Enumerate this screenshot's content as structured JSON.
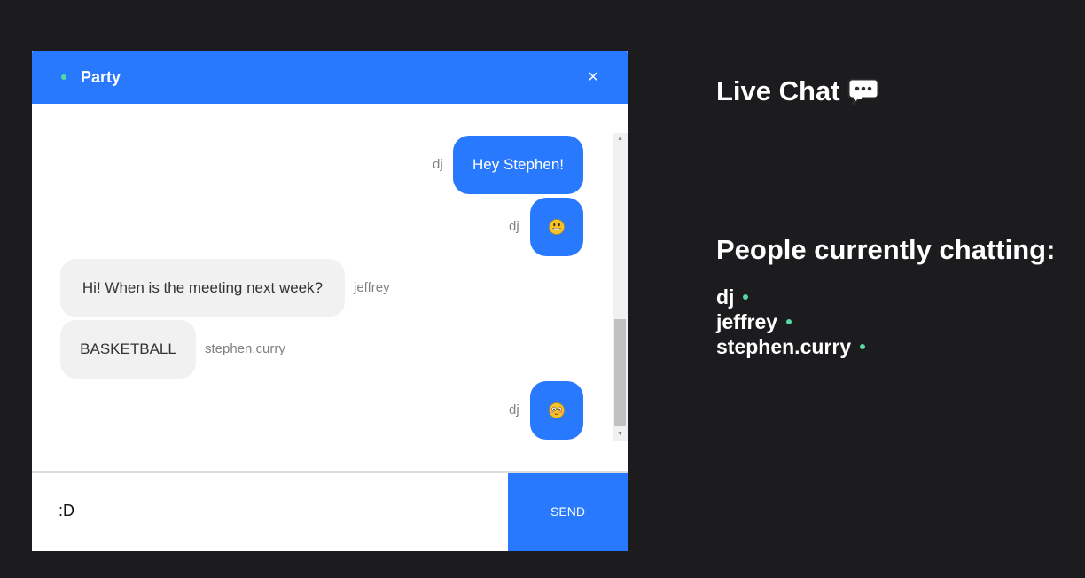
{
  "chat": {
    "room_name": "Party",
    "close_label": "×",
    "messages": [
      {
        "sender": "dj",
        "text": "Hey Stephen!",
        "mine": true
      },
      {
        "sender": "dj",
        "emoji": "grinning-face-emoji",
        "mine": true
      },
      {
        "sender": "jeffrey",
        "text": "Hi! When is the meeting next week?",
        "mine": false
      },
      {
        "sender": "stephen.curry",
        "text": "BASKETBALL",
        "mine": false
      },
      {
        "sender": "dj",
        "emoji": "flushed-face-emoji",
        "mine": true
      }
    ],
    "input_value": ":D",
    "send_label": "SEND"
  },
  "sidebar": {
    "title": "Live Chat",
    "title_icon": "speech-balloon-icon",
    "people_title": "People currently chatting:",
    "people": [
      {
        "name": "dj",
        "status": "online"
      },
      {
        "name": "jeffrey",
        "status": "online"
      },
      {
        "name": "stephen.curry",
        "status": "online"
      }
    ]
  },
  "colors": {
    "background": "#1c1b1d",
    "accent": "#2979ff",
    "online": "#57d9a3",
    "incoming_bubble": "#f1f1f1",
    "outgoing_bubble": "#2979ff"
  }
}
